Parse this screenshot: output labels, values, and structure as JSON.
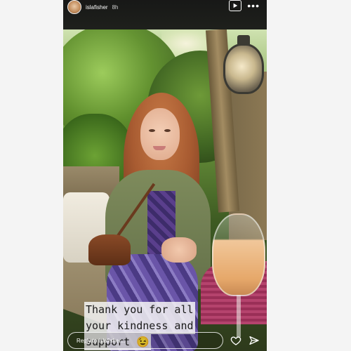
{
  "story": {
    "username": "islafisher",
    "time_ago": "8h",
    "caption_lines": [
      "Thank you for all",
      "your kindness and",
      "support 😉"
    ],
    "reply_placeholder": "Reply to islafisher..."
  },
  "icons": {
    "play": "play-icon",
    "more": "more-icon",
    "like": "heart-icon",
    "share": "send-icon"
  },
  "colors": {
    "background": "#f4f4f4",
    "story_bg": "#2b2f26",
    "text_light": "#ffffff"
  }
}
